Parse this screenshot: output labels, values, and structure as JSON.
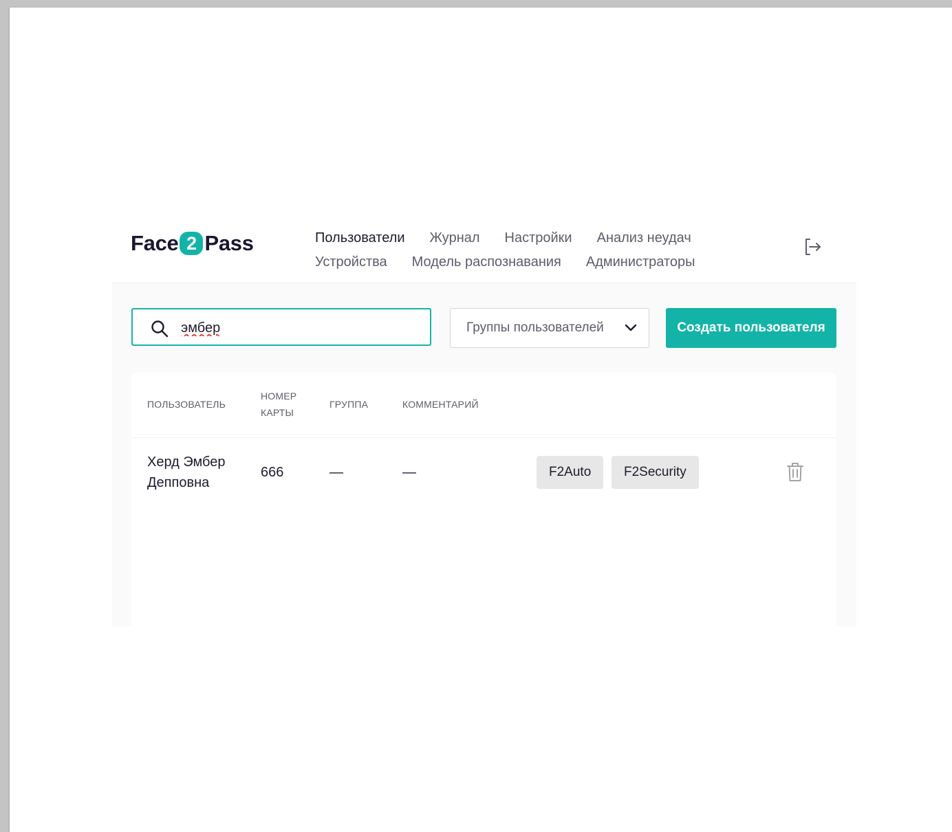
{
  "app": {
    "logo": {
      "left": "Face",
      "badge": "2",
      "right": "Pass"
    },
    "nav": {
      "row1": [
        "Пользователи",
        "Журнал",
        "Настройки",
        "Анализ неудач"
      ],
      "row2": [
        "Устройства",
        "Модель распознавания",
        "Администраторы"
      ],
      "active": "Пользователи"
    },
    "logout_icon": "logout-icon"
  },
  "toolbar": {
    "search_value": "эмбер",
    "search_icon": "search-icon",
    "groups_label": "Группы пользователей",
    "create_label": "Создать пользователя"
  },
  "table": {
    "headers": {
      "user": "Пользователь",
      "card": "Номер карты",
      "group": "Группа",
      "comment": "Комментарий"
    },
    "rows": [
      {
        "name_line1": "Херд Эмбер",
        "name_line2": "Депповна",
        "card": "666",
        "group": "—",
        "comment": "—",
        "tags": [
          "F2Auto",
          "F2Security"
        ]
      }
    ]
  },
  "colors": {
    "accent": "#14b3a8",
    "text": "#1f1a2e",
    "muted": "#5f5b6b"
  }
}
